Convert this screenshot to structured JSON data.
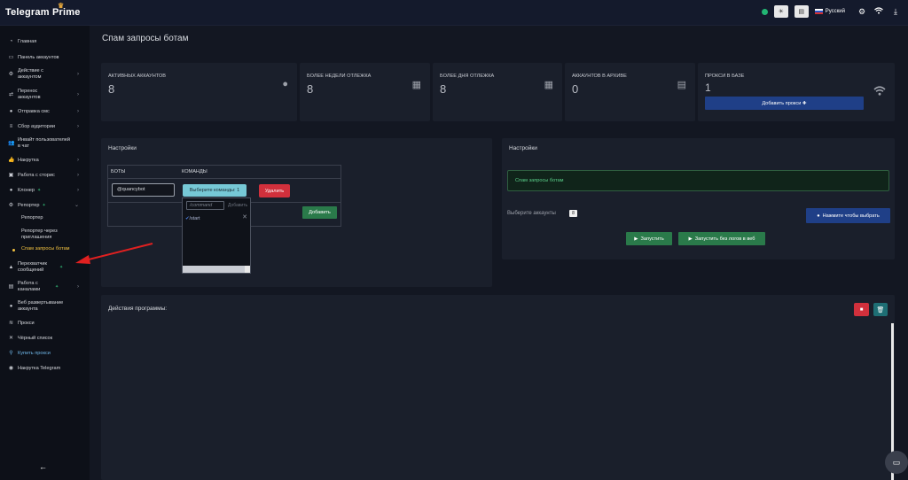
{
  "app": {
    "title": "Telegram Prime"
  },
  "topbar": {
    "language": "Русский"
  },
  "sidebar": {
    "items": [
      {
        "label": "Главная",
        "icon": "speedometer-icon"
      },
      {
        "label": "Панель аккаунтов",
        "icon": "panel-icon"
      },
      {
        "label": "Действие с аккаунтом",
        "icon": "gear-icon"
      },
      {
        "label": "Перенос аккаунтов",
        "icon": "transfer-icon"
      },
      {
        "label": "Отправка смс",
        "icon": "chat-icon"
      },
      {
        "label": "Сбор аудитории",
        "icon": "database-icon"
      },
      {
        "label": "Инвайт пользователей в чат",
        "icon": "users-icon"
      },
      {
        "label": "Накрутка",
        "icon": "thumbs-up-icon"
      },
      {
        "label": "Работа с сторис",
        "icon": "stories-icon"
      },
      {
        "label": "Клонер",
        "icon": "user-clone-icon"
      },
      {
        "label": "Репортер",
        "icon": "reporter-icon"
      }
    ],
    "reporter_sub": [
      "Репортер",
      "Репортер через приглашения",
      "Спам запросы ботам"
    ],
    "items2": [
      {
        "label": "Перехватчик сообщений",
        "icon": "intercept-icon"
      },
      {
        "label": "Работа с каналами",
        "icon": "channel-icon"
      },
      {
        "label": "Веб развертывание аккаунта",
        "icon": "user-icon"
      },
      {
        "label": "Прокси",
        "icon": "wifi-icon"
      },
      {
        "label": "Чёрный список",
        "icon": "x-icon"
      },
      {
        "label": "Купить прокси",
        "icon": "search-icon"
      },
      {
        "label": "Накрутка Telegram",
        "icon": "telegram-icon"
      }
    ],
    "collapse_label": "←"
  },
  "main": {
    "page_title": "Спам запросы ботам",
    "stats": [
      {
        "label": "АКТИВНЫХ АККАУНТОВ",
        "value": "8",
        "icon": "user-icon"
      },
      {
        "label": "БОЛЕЕ НЕДЕЛИ ОТЛЕЖКА",
        "value": "8",
        "icon": "calendar-check-icon"
      },
      {
        "label": "БОЛЕЕ ДНЯ ОТЛЕЖКА",
        "value": "8",
        "icon": "calendar-icon"
      },
      {
        "label": "АККАУНТОВ В АРХИВЕ",
        "value": "0",
        "icon": "file-icon"
      },
      {
        "label": "ПРОКСИ В БАЗЕ",
        "value": "1",
        "icon": "wifi-icon"
      }
    ],
    "add_proxy_label": "Добавить прокси ✚",
    "settings_left": {
      "title": "Настройки",
      "col_bots": "боты",
      "col_commands": "команды",
      "bot_value": "@quancybot",
      "select_label": "Выберите команды: 1",
      "delete_label": "Удалить",
      "add_label": "Добавить",
      "dropdown": {
        "search_placeholder": "/command",
        "add_label": "Добавить",
        "item": "/start"
      }
    },
    "settings_right": {
      "title": "Настройки",
      "status": "Спам запросы ботам",
      "select_accounts_label": "Выберите аккаунты",
      "accounts_count": "8",
      "choose_label": "Нажмите чтобы выбрать",
      "start_label": "Запустить",
      "start_no_logs_label": "Запустить без логов в веб"
    },
    "actions": {
      "title": "Действия программы:"
    }
  },
  "colors": {
    "accent_blue": "#1f3f87",
    "success": "#2a7a4a",
    "danger": "#d1303c",
    "active_yellow": "#f0c040"
  }
}
